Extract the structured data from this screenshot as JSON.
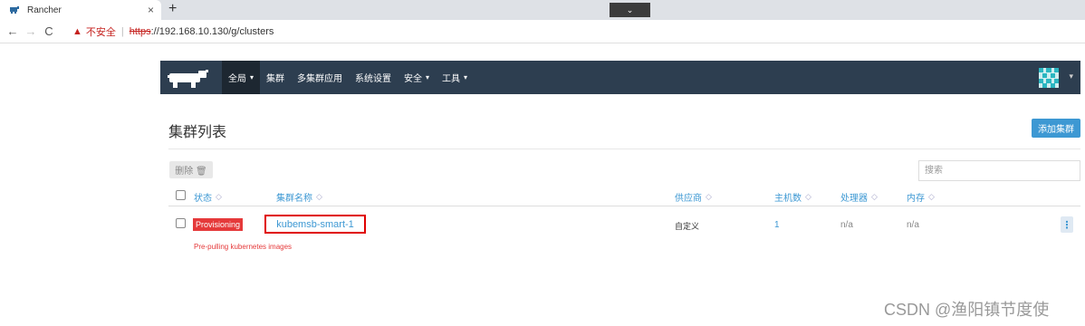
{
  "browser": {
    "tab_title": "Rancher",
    "tab_close": "×",
    "new_tab": "+",
    "dropdown_glyph": "⌄",
    "back_glyph": "←",
    "forward_glyph": "→",
    "reload_glyph": "C",
    "security_warning": "不安全",
    "url_scheme": "https",
    "url_rest": "://192.168.10.130/g/clusters"
  },
  "header": {
    "nav": [
      {
        "label": "全局",
        "has_caret": true
      },
      {
        "label": "集群"
      },
      {
        "label": "多集群应用"
      },
      {
        "label": "系统设置"
      },
      {
        "label": "安全",
        "has_caret": true
      },
      {
        "label": "工具",
        "has_caret": true
      }
    ],
    "caret": "▾",
    "colors": {
      "bar": "#2d3e50",
      "active": "#1d2731",
      "accent": "#3d98d3"
    }
  },
  "page": {
    "title": "集群列表",
    "add_button": "添加集群",
    "delete_button": "删除 🗑",
    "search_placeholder": "搜索"
  },
  "table": {
    "columns": [
      {
        "label": "状态"
      },
      {
        "label": "集群名称"
      },
      {
        "label": "供应商"
      },
      {
        "label": "主机数"
      },
      {
        "label": "处理器"
      },
      {
        "label": "内存"
      }
    ],
    "sort_icon": "◇",
    "rows": [
      {
        "status": "Provisioning",
        "name": "kubemsb-smart-1",
        "provider": "自定义",
        "hosts": "1",
        "cpu": "n/a",
        "memory": "n/a",
        "menu": "⋮",
        "message": "Pre-pulling kubernetes images"
      }
    ]
  },
  "watermark": "CSDN @渔阳镇节度使"
}
